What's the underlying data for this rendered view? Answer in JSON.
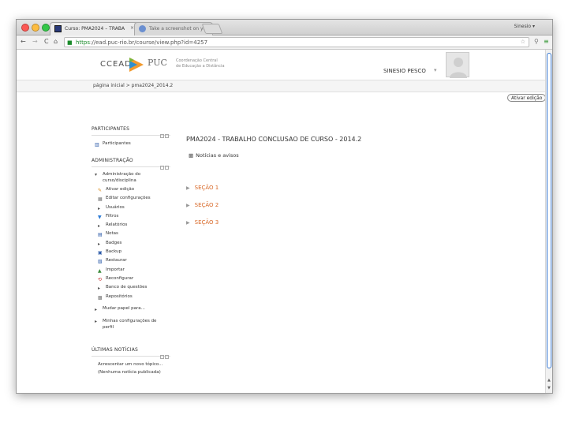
{
  "browser": {
    "tabs": [
      {
        "label": "Curso: PMA2024 – TRABA",
        "close": "×",
        "active": true
      },
      {
        "label": "Take a screenshot on your",
        "close": "×",
        "active": false
      }
    ],
    "profile": "Sinesio ▾",
    "url_scheme": "https",
    "url_rest": "://ead.puc-rio.br/course/view.php?id=4257",
    "icons": {
      "back": "←",
      "forward": "→",
      "reload": "C",
      "home": "⌂",
      "lock": "🔒",
      "star": "☆",
      "search": "⚲",
      "menu": "≡"
    }
  },
  "header": {
    "logo_ccead": "CCEAD",
    "logo_puc": "PUC",
    "logo_sub_line1": "Coordenação Central",
    "logo_sub_line2": "de Educação a Distância",
    "username": "SINESIO PESCO",
    "user_caret": "▾"
  },
  "breadcrumb": "página inicial  >  pma2024_2014.2",
  "edit_button": "Ativar edição",
  "blocks": {
    "participants": {
      "title": "PARTICIPANTES",
      "items": [
        {
          "label": "Participantes",
          "icon": "people-icon"
        }
      ]
    },
    "admin": {
      "title": "ADMINISTRAÇÃO",
      "root_line1": "Administração do",
      "root_line2": "curso/disciplina",
      "items": [
        {
          "label": "Ativar edição",
          "icon": "pencil-icon"
        },
        {
          "label": "Editar configurações",
          "icon": "settings-icon"
        },
        {
          "label": "Usuários",
          "icon": "expand-icon"
        },
        {
          "label": "Filtros",
          "icon": "filter-icon"
        },
        {
          "label": "Relatórios",
          "icon": "expand-icon"
        },
        {
          "label": "Notas",
          "icon": "grades-icon"
        },
        {
          "label": "Badges",
          "icon": "expand-icon"
        },
        {
          "label": "Backup",
          "icon": "backup-icon"
        },
        {
          "label": "Restaurar",
          "icon": "restore-icon"
        },
        {
          "label": "Importar",
          "icon": "import-icon"
        },
        {
          "label": "Reconfigurar",
          "icon": "reset-icon"
        },
        {
          "label": "Banco de questões",
          "icon": "expand-icon"
        },
        {
          "label": "Repositórios",
          "icon": "repository-icon"
        }
      ],
      "switch_role": "Mudar papel para...",
      "profile_line1": "Minhas configurações de",
      "profile_line2": "perfil"
    },
    "news": {
      "title": "ÚLTIMAS NOTÍCIAS",
      "add_topic": "Acrescentar um novo tópico...",
      "empty": "(Nenhuma notícia publicada)"
    }
  },
  "main": {
    "course_title": "PMA2024 - TRABALHO CONCLUSAO DE CURSO - 2014.2",
    "news_forum": "Notícias e avisos",
    "sections": [
      "SEÇÃO 1",
      "SEÇÃO 2",
      "SEÇÃO 3"
    ]
  }
}
